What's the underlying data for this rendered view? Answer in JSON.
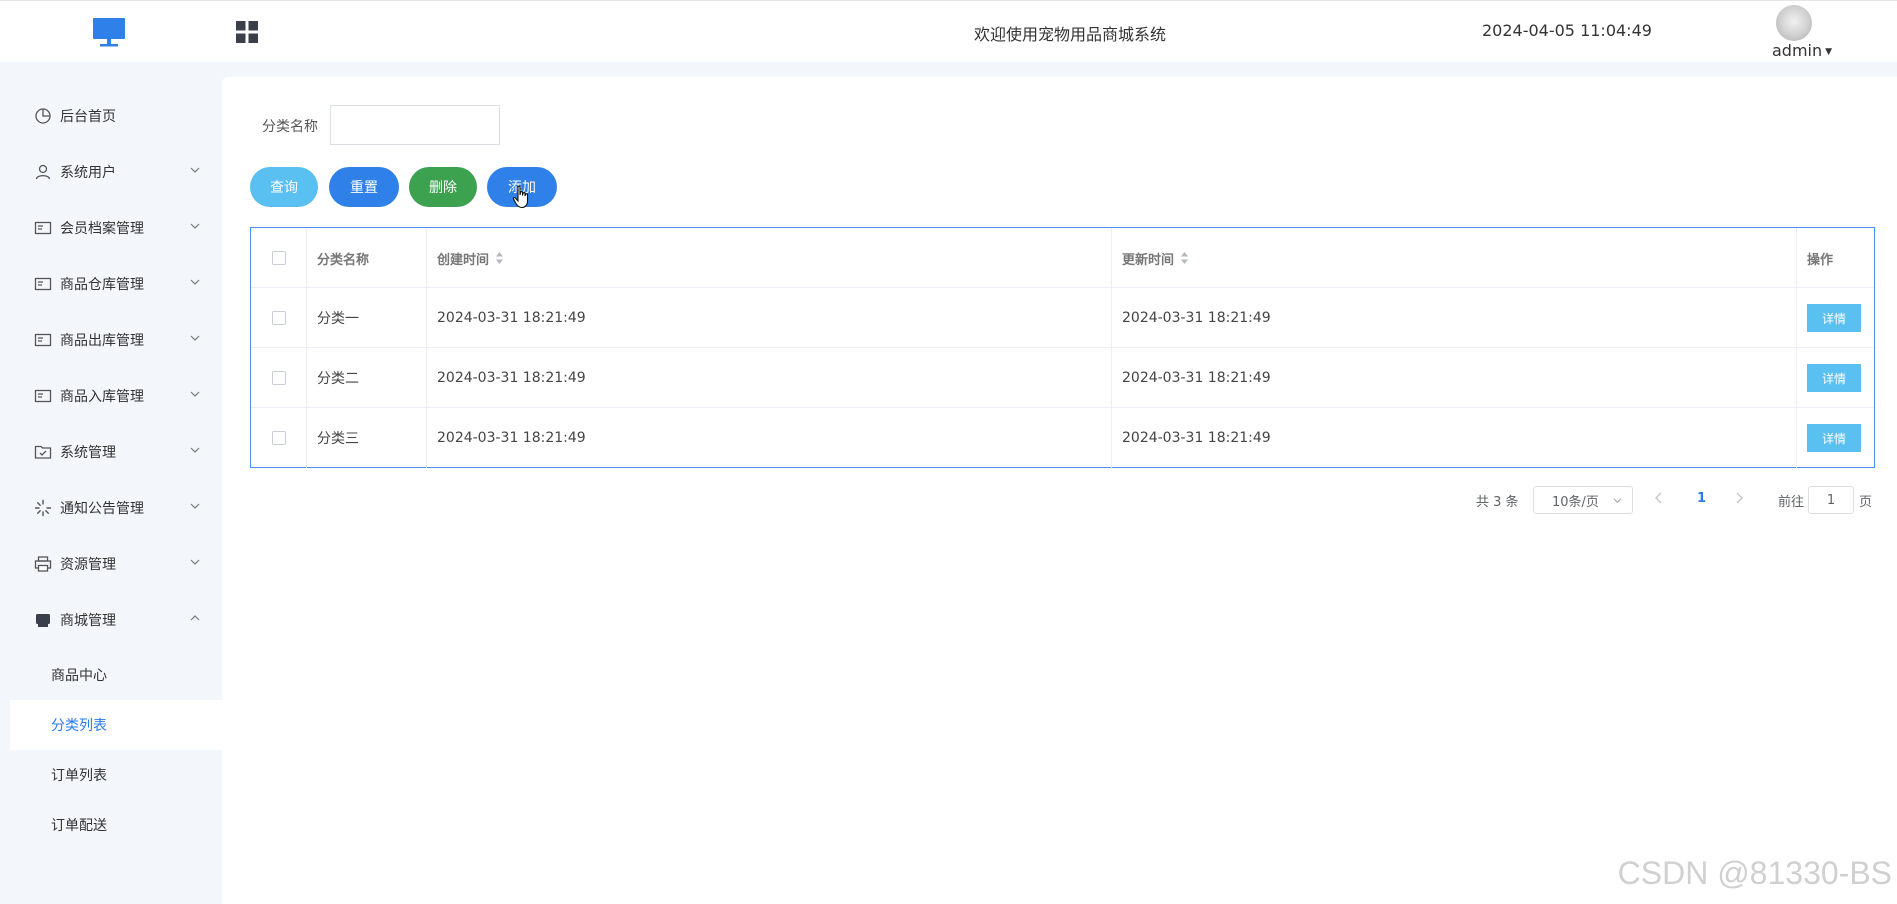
{
  "header": {
    "welcome": "欢迎使用宠物用品商城系统",
    "datetime": "2024-04-05 11:04:49",
    "username": "admin"
  },
  "sidebar": {
    "items": [
      {
        "label": "后台首页",
        "icon": "pie-chart-icon"
      },
      {
        "label": "系统用户",
        "icon": "user-icon"
      },
      {
        "label": "会员档案管理",
        "icon": "id-card-icon"
      },
      {
        "label": "商品仓库管理",
        "icon": "id-card-icon"
      },
      {
        "label": "商品出库管理",
        "icon": "id-card-icon"
      },
      {
        "label": "商品入库管理",
        "icon": "id-card-icon"
      },
      {
        "label": "系统管理",
        "icon": "folder-check-icon"
      },
      {
        "label": "通知公告管理",
        "icon": "loading-icon"
      },
      {
        "label": "资源管理",
        "icon": "printer-icon"
      },
      {
        "label": "商城管理",
        "icon": "shop-icon"
      }
    ],
    "subitems": [
      {
        "label": "商品中心"
      },
      {
        "label": "分类列表"
      },
      {
        "label": "订单列表"
      },
      {
        "label": "订单配送"
      }
    ]
  },
  "search": {
    "label": "分类名称",
    "value": ""
  },
  "toolbar": {
    "query": "查询",
    "reset": "重置",
    "delete": "删除",
    "add": "添加"
  },
  "table": {
    "headers": {
      "name": "分类名称",
      "created": "创建时间",
      "updated": "更新时间",
      "action": "操作"
    },
    "rows": [
      {
        "name": "分类一",
        "created": "2024-03-31 18:21:49",
        "updated": "2024-03-31 18:21:49",
        "action": "详情"
      },
      {
        "name": "分类二",
        "created": "2024-03-31 18:21:49",
        "updated": "2024-03-31 18:21:49",
        "action": "详情"
      },
      {
        "name": "分类三",
        "created": "2024-03-31 18:21:49",
        "updated": "2024-03-31 18:21:49",
        "action": "详情"
      }
    ]
  },
  "pagination": {
    "total": "共 3 条",
    "page_size": "10条/页",
    "current": "1",
    "goto_label": "前往",
    "goto_value": "1",
    "page_label": "页"
  },
  "watermark": "CSDN @81330-BS",
  "colors": {
    "primary": "#2f80e8",
    "light_blue": "#5ac0f2",
    "green": "#3ca24f",
    "active_text": "#2a7bf0"
  }
}
